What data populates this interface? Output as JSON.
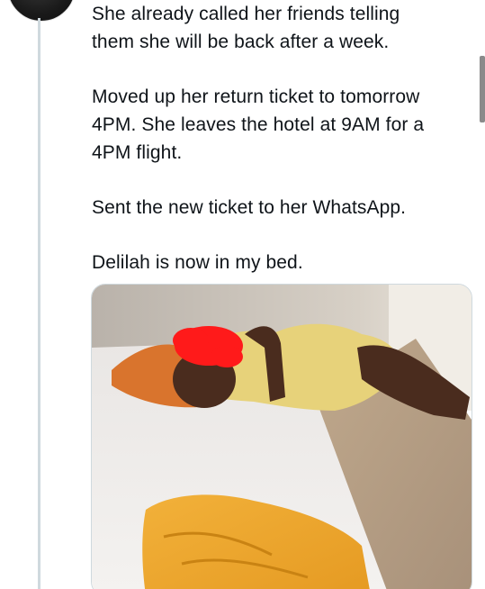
{
  "tweet": {
    "lines": {
      "p1": "She already called her friends telling them she will be back after a week.",
      "p2": "Moved up her return ticket to tomorrow 4PM. She leaves the hotel at 9AM for a 4PM flight.",
      "p3": "Sent the new ticket to her WhatsApp.",
      "p4": "Delilah is now in my bed."
    }
  },
  "colors": {
    "text": "#0f1419",
    "thread_line": "#cfd9de",
    "background": "#ffffff"
  }
}
